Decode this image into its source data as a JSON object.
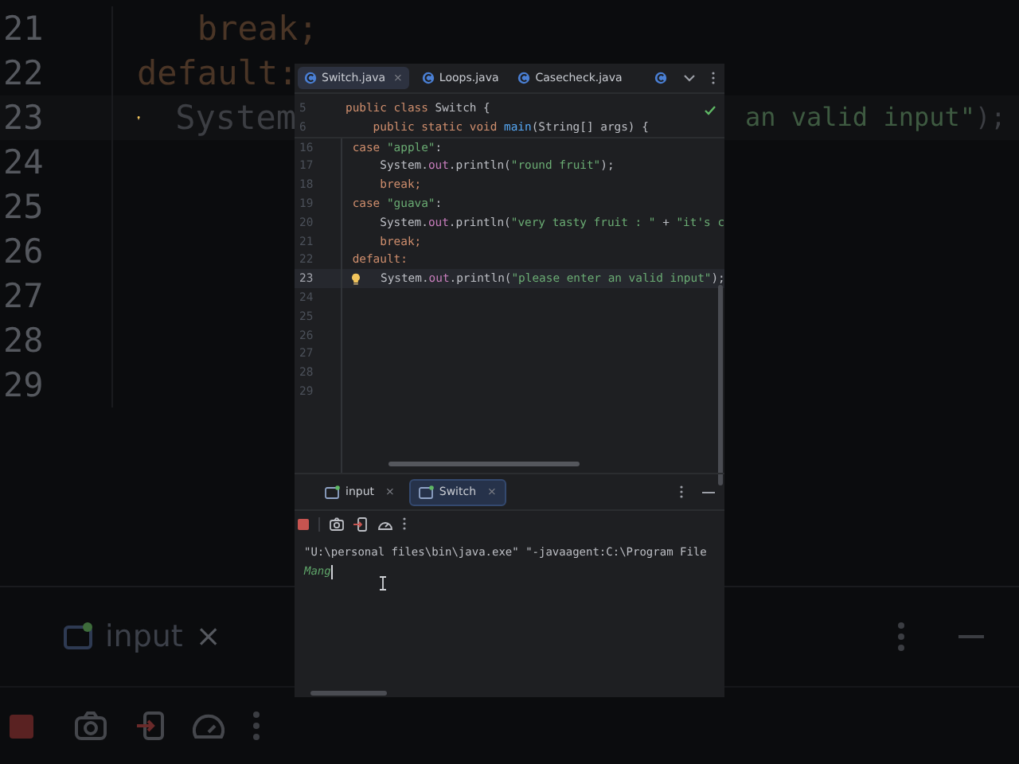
{
  "backdrop": {
    "lines": [
      {
        "number": "21",
        "kind": "code",
        "segments": [
          {
            "kind": "kw",
            "text": "   break;"
          }
        ]
      },
      {
        "number": "22",
        "kind": "code",
        "segments": [
          {
            "kind": "kw",
            "text": "default:"
          }
        ]
      },
      {
        "number": "23",
        "kind": "hint",
        "segments": [
          {
            "kind": "plain",
            "text": "System"
          }
        ],
        "tail": [
          {
            "kind": "str",
            "text": "an valid input\""
          },
          {
            "kind": "plain",
            "text": ");"
          }
        ]
      },
      {
        "number": "24",
        "kind": "code"
      },
      {
        "number": "25",
        "kind": "code"
      },
      {
        "number": "26",
        "kind": "code"
      },
      {
        "number": "27",
        "kind": "code"
      },
      {
        "number": "28",
        "kind": "code"
      },
      {
        "number": "29",
        "kind": "code"
      }
    ],
    "tabs": [
      {
        "label": "input",
        "selected": false,
        "close": "×"
      }
    ]
  },
  "editor": {
    "tabs": [
      {
        "label": "Switch.java",
        "selected": true,
        "close": "×"
      },
      {
        "label": "Loops.java",
        "selected": false
      },
      {
        "label": "Casecheck.java",
        "selected": false
      }
    ],
    "sticky_lines": [
      {
        "number": "5",
        "segments": [
          {
            "kind": "kw",
            "text": "public class "
          },
          {
            "kind": "plain",
            "text": "Switch {"
          }
        ]
      },
      {
        "number": "6",
        "segments": [
          {
            "kind": "kw",
            "text": "    public static void "
          },
          {
            "kind": "method",
            "text": "main"
          },
          {
            "kind": "plain",
            "text": "(String[] args) {"
          }
        ]
      }
    ],
    "lines": [
      {
        "number": "16",
        "kind": "code",
        "segments": [
          {
            "kind": "kw",
            "text": " case "
          },
          {
            "kind": "str",
            "text": "\"apple\""
          },
          {
            "kind": "plain",
            "text": ":"
          }
        ]
      },
      {
        "number": "17",
        "kind": "code",
        "segments": [
          {
            "kind": "plain",
            "text": "     System."
          },
          {
            "kind": "field",
            "text": "out"
          },
          {
            "kind": "plain",
            "text": ".println("
          },
          {
            "kind": "str",
            "text": "\"round fruit\""
          },
          {
            "kind": "plain",
            "text": ");"
          }
        ]
      },
      {
        "number": "18",
        "kind": "code",
        "segments": [
          {
            "kind": "kw",
            "text": "     break;"
          }
        ]
      },
      {
        "number": "19",
        "kind": "code",
        "segments": [
          {
            "kind": "kw",
            "text": " case "
          },
          {
            "kind": "str",
            "text": "\"guava\""
          },
          {
            "kind": "plain",
            "text": ":"
          }
        ]
      },
      {
        "number": "20",
        "kind": "code",
        "segments": [
          {
            "kind": "plain",
            "text": "     System."
          },
          {
            "kind": "field",
            "text": "out"
          },
          {
            "kind": "plain",
            "text": ".println("
          },
          {
            "kind": "str",
            "text": "\"very tasty fruit : \""
          },
          {
            "kind": "plain",
            "text": " + "
          },
          {
            "kind": "str",
            "text": "\"it's c"
          }
        ]
      },
      {
        "number": "21",
        "kind": "code",
        "segments": [
          {
            "kind": "kw",
            "text": "     break;"
          }
        ]
      },
      {
        "number": "22",
        "kind": "code",
        "segments": [
          {
            "kind": "kw",
            "text": " default:"
          }
        ]
      },
      {
        "number": "23",
        "kind": "hint",
        "segments": [
          {
            "kind": "plain",
            "text": "System."
          },
          {
            "kind": "field",
            "text": "out"
          },
          {
            "kind": "plain",
            "text": ".println("
          },
          {
            "kind": "str",
            "text": "\"please enter an valid input\""
          },
          {
            "kind": "plain",
            "text": ");"
          }
        ]
      },
      {
        "number": "24",
        "kind": "code"
      },
      {
        "number": "25",
        "kind": "code"
      },
      {
        "number": "26",
        "kind": "code"
      },
      {
        "number": "27",
        "kind": "code"
      },
      {
        "number": "28",
        "kind": "code"
      },
      {
        "number": "29",
        "kind": "code"
      }
    ]
  },
  "run_panel": {
    "tabs": [
      {
        "label": "input",
        "selected": false,
        "close": "×"
      },
      {
        "label": "Switch",
        "selected": true,
        "close": "×"
      }
    ],
    "console": [
      {
        "kind": "output",
        "text": "\"U:\\personal files\\bin\\java.exe\" \"-javaagent:C:\\Program File"
      },
      {
        "kind": "input",
        "text": "Mang"
      }
    ]
  }
}
